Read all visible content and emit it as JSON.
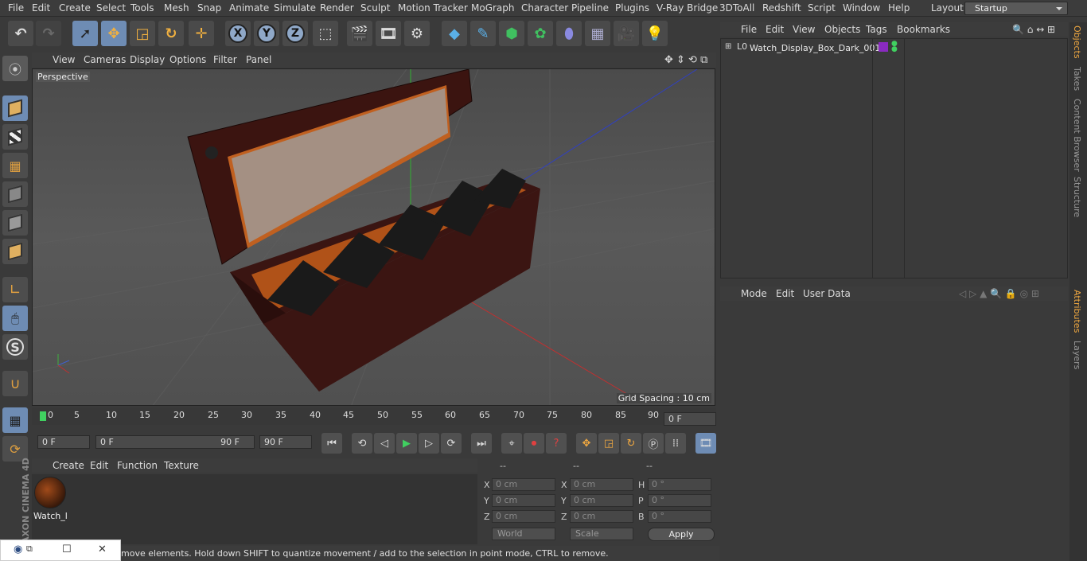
{
  "menubar": {
    "items": [
      "File",
      "Edit",
      "Create",
      "Select",
      "Tools",
      "Mesh",
      "Snap",
      "Animate",
      "Simulate",
      "Render",
      "Sculpt",
      "Motion Tracker",
      "MoGraph",
      "Character",
      "Pipeline",
      "Plugins",
      "V-Ray Bridge",
      "3DToAll",
      "Redshift",
      "Script",
      "Window",
      "Help"
    ],
    "layout_label": "Layout:",
    "layout_value": "Startup"
  },
  "toolbar": {
    "icons": [
      "undo-icon",
      "redo-icon",
      "select-icon",
      "move-icon",
      "scale-icon",
      "rotate-icon",
      "live-select-icon",
      "x-axis-icon",
      "y-axis-icon",
      "z-axis-icon",
      "coordinate-system-icon",
      "render-view-icon",
      "render-picture-viewer-icon",
      "render-settings-icon",
      "cube-icon",
      "pen-icon",
      "subdivision-icon",
      "cloner-icon",
      "deformer-icon",
      "floor-icon",
      "camera-icon",
      "light-icon"
    ],
    "axis_x": "X",
    "axis_y": "Y",
    "axis_z": "Z"
  },
  "viewport": {
    "menu": [
      "View",
      "Cameras",
      "Display",
      "Options",
      "Filter",
      "Panel"
    ],
    "label": "Perspective",
    "grid_spacing": "Grid Spacing : 10 cm"
  },
  "timeline": {
    "ticks": [
      "0",
      "5",
      "10",
      "15",
      "20",
      "25",
      "30",
      "35",
      "40",
      "45",
      "50",
      "55",
      "60",
      "65",
      "70",
      "75",
      "80",
      "85",
      "90"
    ],
    "current_frame": "0 F"
  },
  "transport": {
    "start_field": "0 F",
    "range_start": "0 F",
    "range_end": "90 F",
    "end_field": "90 F"
  },
  "material_manager": {
    "menu": [
      "Create",
      "Edit",
      "Function",
      "Texture"
    ],
    "material_name": "Watch_l"
  },
  "coordinates": {
    "header": [
      "--",
      "--",
      "--"
    ],
    "rows": [
      {
        "l1": "X",
        "v1": "0 cm",
        "l2": "X",
        "v2": "0 cm",
        "l3": "H",
        "v3": "0 °"
      },
      {
        "l1": "Y",
        "v1": "0 cm",
        "l2": "Y",
        "v2": "0 cm",
        "l3": "P",
        "v3": "0 °"
      },
      {
        "l1": "Z",
        "v1": "0 cm",
        "l2": "Z",
        "v2": "0 cm",
        "l3": "B",
        "v3": "0 °"
      }
    ],
    "mode_world": "World",
    "mode_scale": "Scale",
    "apply": "Apply"
  },
  "status": {
    "text": "move elements. Hold down SHIFT to quantize movement / add to the selection in point mode, CTRL to remove."
  },
  "object_manager": {
    "menu": [
      "File",
      "Edit",
      "View",
      "Objects",
      "Tags",
      "Bookmarks"
    ],
    "object_name": "Watch_Display_Box_Dark_001"
  },
  "attributes": {
    "menu": [
      "Mode",
      "Edit",
      "User Data"
    ]
  },
  "side_tabs": [
    "Objects",
    "Takes",
    "Content Browser",
    "Structure",
    "Attributes",
    "Layers"
  ],
  "brand": "MAXON CINEMA 4D",
  "colors": {
    "accent": "#6e8cb4",
    "highlight": "#f0a840",
    "wood": "#3b1410"
  }
}
